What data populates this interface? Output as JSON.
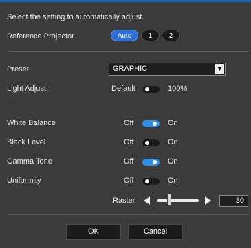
{
  "instruction": "Select the setting to automatically adjust.",
  "reference_projector": {
    "label": "Reference Projector",
    "options": [
      "Auto",
      "1",
      "2"
    ],
    "selected": "Auto"
  },
  "preset": {
    "label": "Preset",
    "value": "GRAPHIC"
  },
  "light_adjust": {
    "label": "Light Adjust",
    "default_label": "Default",
    "value_label": "100%",
    "state": "off"
  },
  "toggles": [
    {
      "label": "White Balance",
      "off": "Off",
      "on": "On",
      "state": "on"
    },
    {
      "label": "Black Level",
      "off": "Off",
      "on": "On",
      "state": "off"
    },
    {
      "label": "Gamma Tone",
      "off": "Off",
      "on": "On",
      "state": "on"
    },
    {
      "label": "Uniformity",
      "off": "Off",
      "on": "On",
      "state": "off"
    }
  ],
  "raster": {
    "label": "Raster",
    "value": "30"
  },
  "buttons": {
    "ok": "OK",
    "cancel": "Cancel"
  },
  "colors": {
    "accent": "#2f8fe8",
    "background": "#3b3b3b"
  }
}
